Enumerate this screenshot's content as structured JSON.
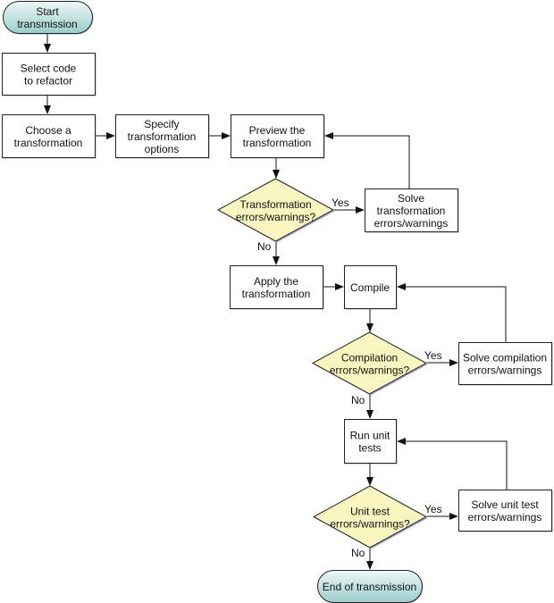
{
  "diagram": {
    "type": "flowchart",
    "colors": {
      "terminal_top": "#eef8f7",
      "terminal_bottom": "#98cdca",
      "decision_fill": "#f8f5bf",
      "process_fill": "#ffffff",
      "stroke": "#222222",
      "shadow": "#8a88c8"
    },
    "nodes": {
      "start": {
        "kind": "terminal",
        "lines": [
          "Start",
          "transmission"
        ]
      },
      "select_code": {
        "kind": "process",
        "lines": [
          "Select code",
          "to refactor"
        ]
      },
      "choose_transformation": {
        "kind": "process",
        "lines": [
          "Choose a",
          "transformation"
        ]
      },
      "specify_options": {
        "kind": "process",
        "lines": [
          "Specify",
          "transformation",
          "options"
        ]
      },
      "preview": {
        "kind": "process",
        "lines": [
          "Preview the",
          "transformation"
        ]
      },
      "transformation_check": {
        "kind": "decision",
        "lines": [
          "Transformation",
          "errors/warnings?"
        ]
      },
      "solve_transformation": {
        "kind": "process",
        "lines": [
          "Solve",
          "transformation",
          "errors/warnings"
        ]
      },
      "apply": {
        "kind": "process",
        "lines": [
          "Apply the",
          "transformation"
        ]
      },
      "compile": {
        "kind": "process",
        "lines": [
          "Compile"
        ]
      },
      "compilation_check": {
        "kind": "decision",
        "lines": [
          "Compilation",
          "errors/warnings?"
        ]
      },
      "solve_compilation": {
        "kind": "process",
        "lines": [
          "Solve compilation",
          "errors/warnings"
        ]
      },
      "run_tests": {
        "kind": "process",
        "lines": [
          "Run unit",
          "tests"
        ]
      },
      "unit_test_check": {
        "kind": "decision",
        "lines": [
          "Unit test",
          "errors/warnings?"
        ]
      },
      "solve_unit_test": {
        "kind": "process",
        "lines": [
          "Solve unit test",
          "errors/warnings"
        ]
      },
      "end": {
        "kind": "terminal",
        "lines": [
          "End of transmission"
        ]
      }
    },
    "edges": [
      {
        "from": "start",
        "to": "select_code",
        "label": ""
      },
      {
        "from": "select_code",
        "to": "choose_transformation",
        "label": ""
      },
      {
        "from": "choose_transformation",
        "to": "specify_options",
        "label": ""
      },
      {
        "from": "specify_options",
        "to": "preview",
        "label": ""
      },
      {
        "from": "preview",
        "to": "transformation_check",
        "label": ""
      },
      {
        "from": "transformation_check",
        "to": "solve_transformation",
        "label": "Yes"
      },
      {
        "from": "solve_transformation",
        "to": "preview",
        "label": ""
      },
      {
        "from": "transformation_check",
        "to": "apply",
        "label": "No"
      },
      {
        "from": "apply",
        "to": "compile",
        "label": ""
      },
      {
        "from": "compile",
        "to": "compilation_check",
        "label": ""
      },
      {
        "from": "compilation_check",
        "to": "solve_compilation",
        "label": "Yes"
      },
      {
        "from": "solve_compilation",
        "to": "compile",
        "label": ""
      },
      {
        "from": "compilation_check",
        "to": "run_tests",
        "label": "No"
      },
      {
        "from": "run_tests",
        "to": "unit_test_check",
        "label": ""
      },
      {
        "from": "unit_test_check",
        "to": "solve_unit_test",
        "label": "Yes"
      },
      {
        "from": "solve_unit_test",
        "to": "run_tests",
        "label": ""
      },
      {
        "from": "unit_test_check",
        "to": "end",
        "label": "No"
      }
    ]
  }
}
